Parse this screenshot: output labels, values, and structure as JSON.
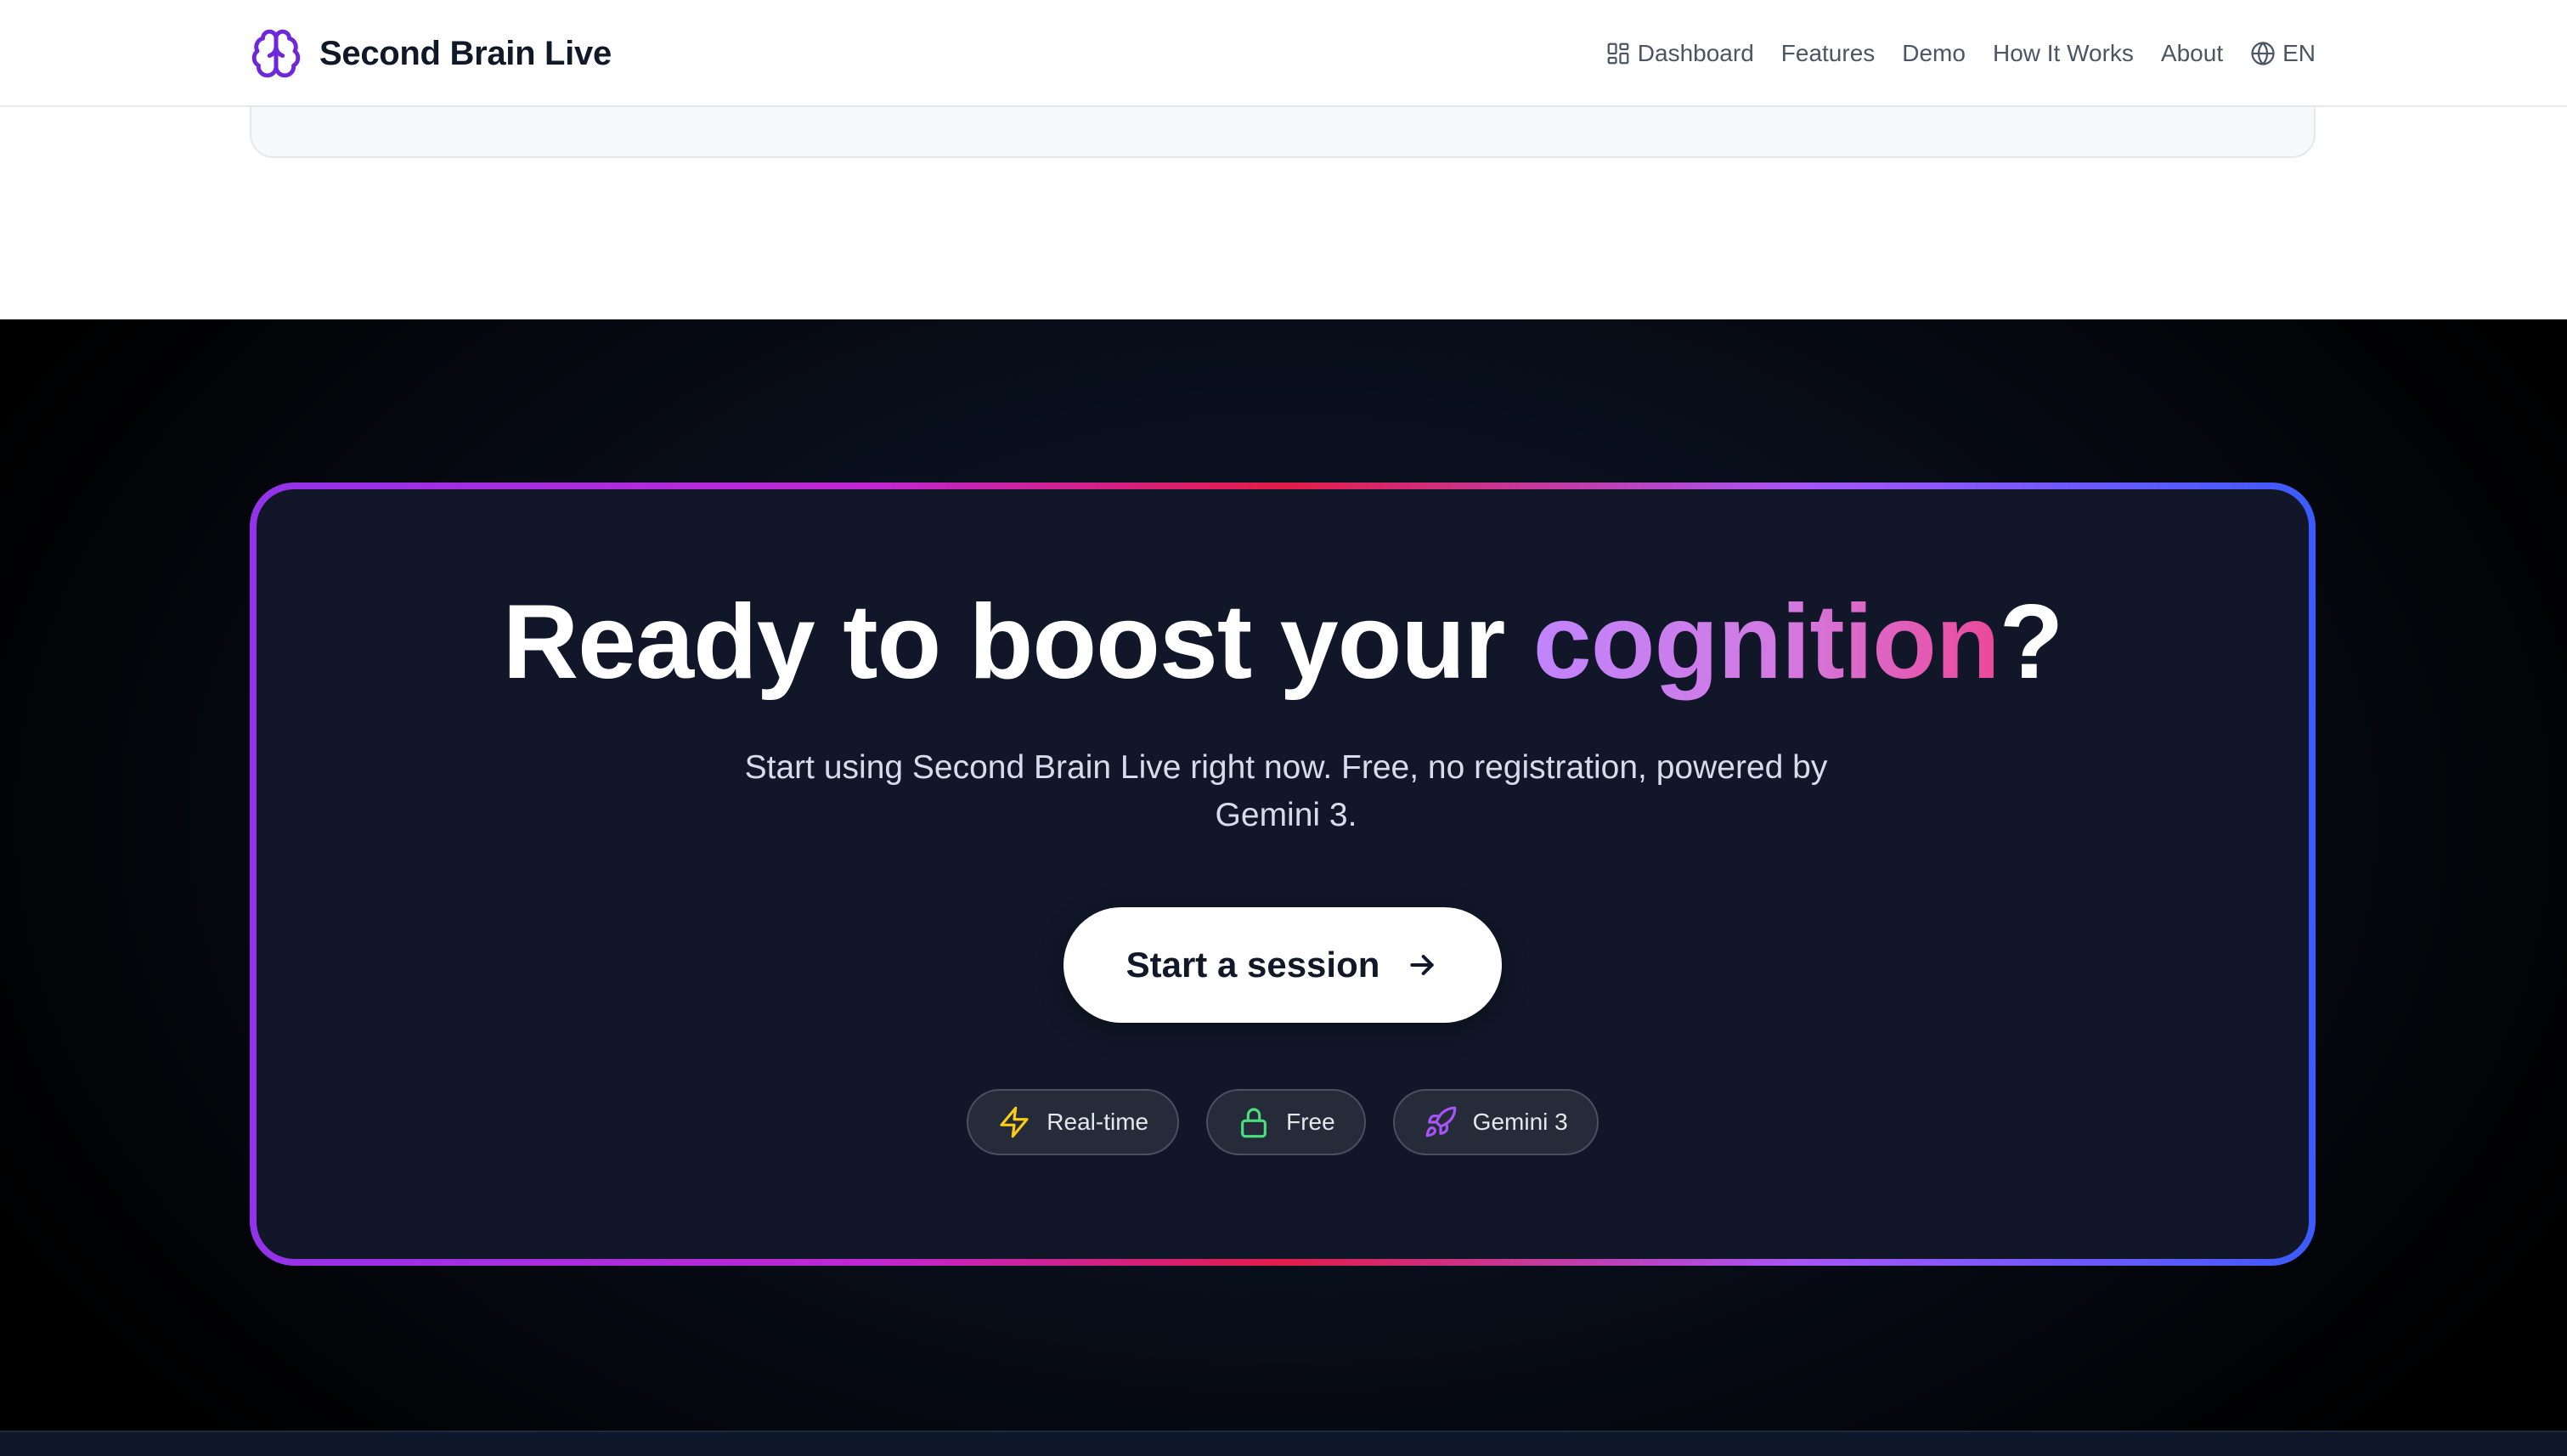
{
  "navbar": {
    "brand_name": "Second Brain Live",
    "links": [
      {
        "label": "Dashboard",
        "icon": "dashboard-grid-icon"
      },
      {
        "label": "Features"
      },
      {
        "label": "Demo"
      },
      {
        "label": "How It Works"
      },
      {
        "label": "About"
      },
      {
        "label": "EN",
        "icon": "globe-icon"
      }
    ]
  },
  "cta": {
    "title_prefix": "Ready to boost your ",
    "title_highlight": "cognition",
    "title_suffix": "?",
    "subtitle": "Start using Second Brain Live right now. Free, no registration, powered by Gemini 3.",
    "button_label": "Start a session",
    "badges": [
      {
        "label": "Real-time",
        "icon": "lightning-icon",
        "color": "#facc15"
      },
      {
        "label": "Free",
        "icon": "lock-icon",
        "color": "#4ade80"
      },
      {
        "label": "Gemini 3",
        "icon": "rocket-icon",
        "color": "#a855f7"
      }
    ]
  },
  "colors": {
    "brand_accent": "#6d28d9",
    "dark_background": "#111729",
    "border_gradient": [
      "#9333ea",
      "#e11d48",
      "#3b5bfd"
    ]
  }
}
